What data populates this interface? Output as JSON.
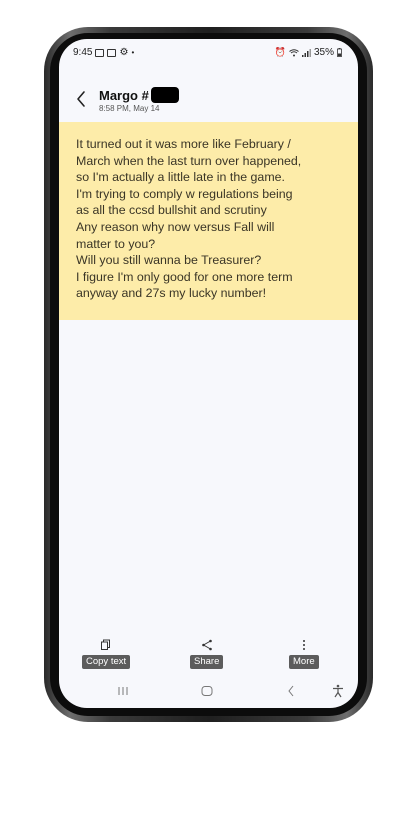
{
  "status_bar": {
    "time": "9:45",
    "battery": "35%",
    "notification_icons": [
      "image-icon",
      "gallery-icon",
      "settings-icon",
      "dot-icon"
    ],
    "system_icons": [
      "alarm-icon",
      "wifi-icon",
      "signal-icon",
      "battery-icon"
    ]
  },
  "header": {
    "contact_name": "Margo #",
    "timestamp": "8:58 PM, May 14"
  },
  "message": {
    "background_color": "#fdeca9",
    "lines": [
      "It turned out it was more like February /",
      "March when the last turn over happened,",
      "so I'm actually a little late in the game.",
      "I'm trying to comply w regulations being",
      "as all the ccsd bullshit and scrutiny",
      "Any reason why now versus Fall will",
      "matter to you?",
      "Will you still wanna be Treasurer?",
      "I figure I'm only good for one more term",
      "anyway and 27s my lucky number!"
    ]
  },
  "toolbar": {
    "copy_label": "Copy text",
    "share_label": "Share",
    "more_label": "More"
  },
  "nav": {
    "icons": [
      "recents-icon",
      "home-icon",
      "back-icon",
      "accessibility-icon"
    ]
  }
}
